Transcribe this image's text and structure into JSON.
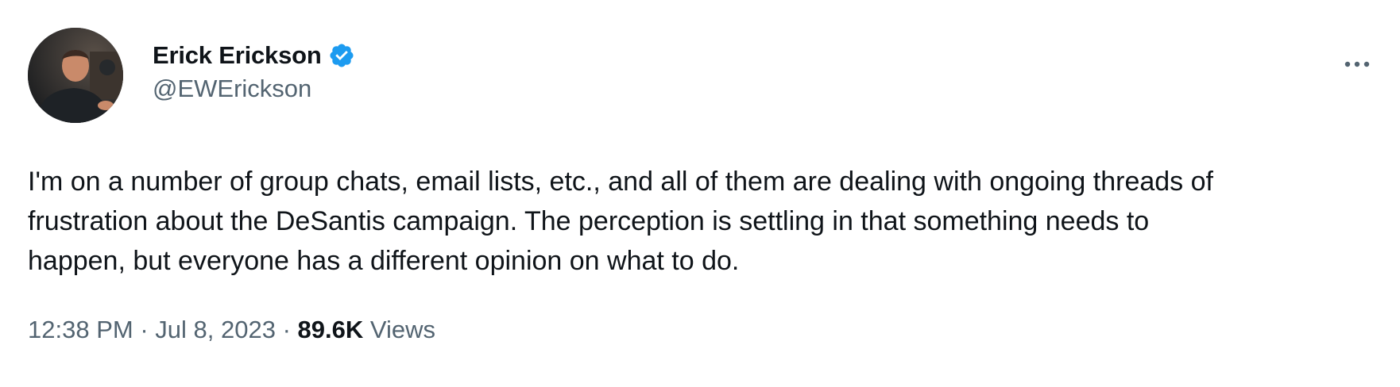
{
  "author": {
    "display_name": "Erick Erickson",
    "handle": "@EWErickson",
    "verified": true,
    "verified_color": "#1d9bf0"
  },
  "icons": {
    "verified": "verified-badge-icon",
    "more": "more-options-icon"
  },
  "tweet": {
    "text_lines": [
      "I'm on a number of group chats, email lists, etc., and all of them are dealing with ongoing threads of",
      "frustration about the DeSantis campaign. The perception is settling in that something needs to",
      "happen, but everyone has a different opinion on what to do."
    ]
  },
  "meta": {
    "time": "12:38 PM",
    "separator": "·",
    "date": "Jul 8, 2023",
    "views_count": "89.6K",
    "views_label": "Views"
  },
  "colors": {
    "text_primary": "#0f1419",
    "text_secondary": "#536471",
    "accent": "#1d9bf0"
  }
}
